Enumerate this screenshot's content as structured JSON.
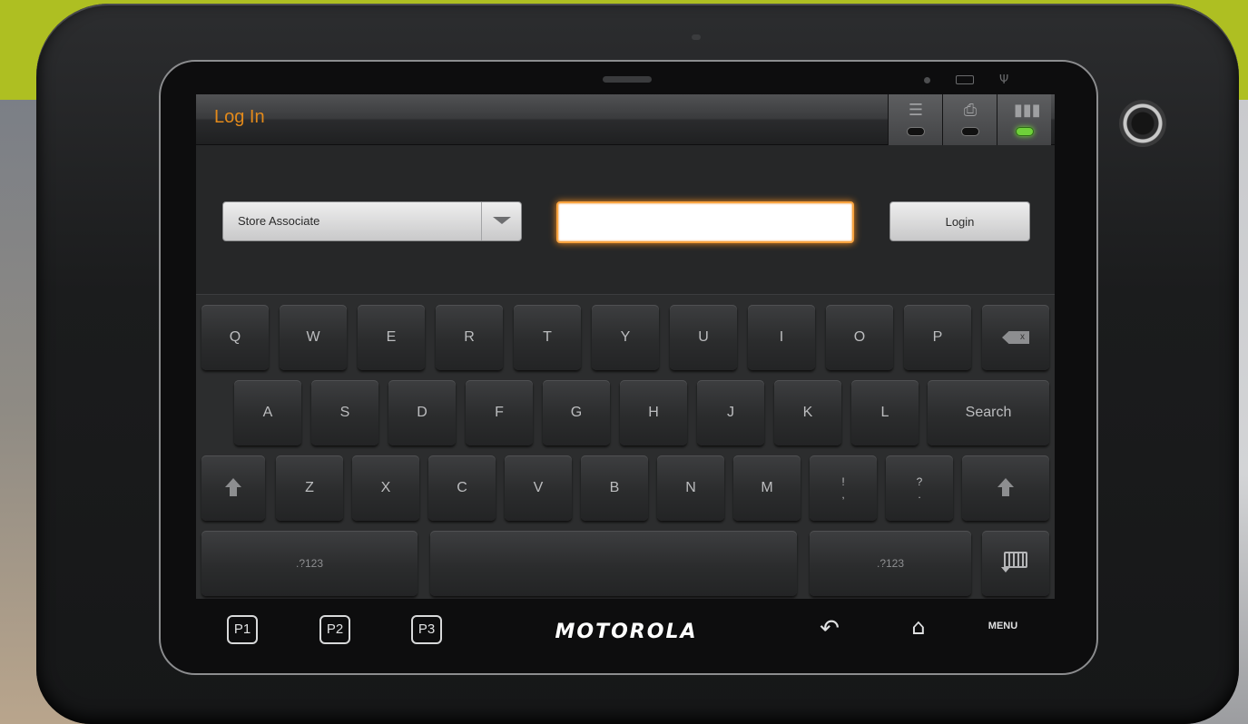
{
  "device": {
    "brand": "MOTOROLA",
    "bezel_buttons": [
      "P1",
      "P2",
      "P3"
    ],
    "menu_label": "MENU",
    "back_icon": "back-arrow-icon",
    "home_icon": "home-icon"
  },
  "titlebar": {
    "title": "Log In",
    "title_color": "#e38a1b",
    "buttons": [
      {
        "icon": "display-icon",
        "led": "off"
      },
      {
        "icon": "printer-icon",
        "led": "off"
      },
      {
        "icon": "barcode-icon",
        "led": "on"
      }
    ]
  },
  "login_form": {
    "role_select": {
      "selected": "Store Associate"
    },
    "input": {
      "value": "",
      "placeholder": ""
    },
    "login_button": "Login",
    "accent_color": "#f08a1c"
  },
  "keyboard": {
    "row1": [
      "Q",
      "W",
      "E",
      "R",
      "T",
      "Y",
      "U",
      "I",
      "O",
      "P"
    ],
    "row2": [
      "A",
      "S",
      "D",
      "F",
      "G",
      "H",
      "J",
      "K",
      "L"
    ],
    "search_key": "Search",
    "row3": [
      "Z",
      "X",
      "C",
      "V",
      "B",
      "N",
      "M"
    ],
    "punct1": {
      "top": "!",
      "bottom": ","
    },
    "punct2": {
      "top": "?",
      "bottom": "."
    },
    "symbols_left": ".?123",
    "symbols_right": ".?123",
    "backspace_mark": "x"
  }
}
